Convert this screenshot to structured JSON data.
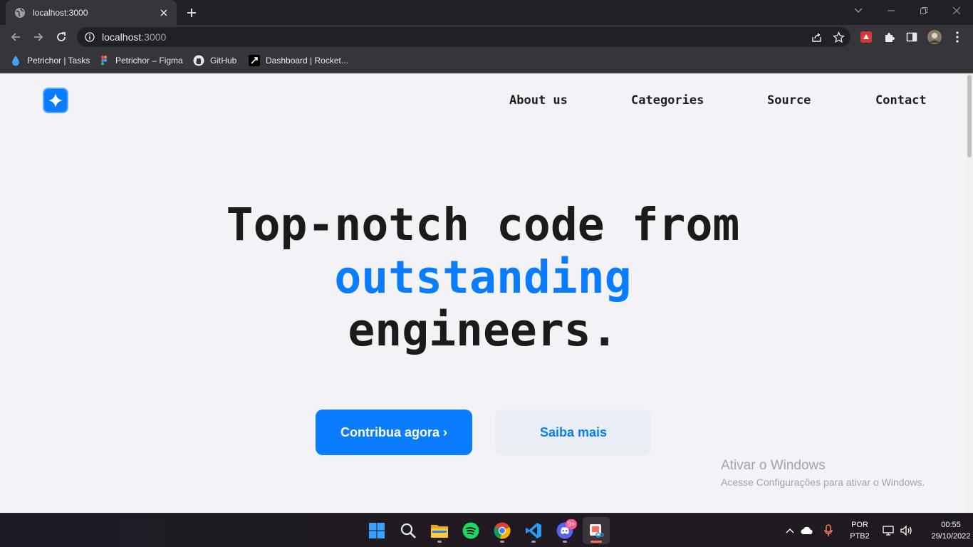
{
  "browser": {
    "tab": {
      "title": "localhost:3000"
    },
    "url": {
      "host": "localhost",
      "port": ":3000"
    },
    "bookmarks": [
      {
        "label": "Petrichor | Tasks"
      },
      {
        "label": "Petrichor – Figma"
      },
      {
        "label": "GitHub"
      },
      {
        "label": "Dashboard | Rocket..."
      }
    ]
  },
  "site": {
    "nav": [
      "About us",
      "Categories",
      "Source",
      "Contact"
    ],
    "hero": {
      "line1": "Top-notch code from",
      "accent": "outstanding",
      "line3": "engineers."
    },
    "buttons": {
      "primary": "Contribua agora ›",
      "secondary": "Saiba mais"
    },
    "colors": {
      "accent": "#0a7cff",
      "background": "#f3f2f7",
      "text": "#1b1b1b"
    }
  },
  "watermark": {
    "title": "Ativar o Windows",
    "subtitle": "Acesse Configurações para ativar o Windows."
  },
  "taskbar": {
    "apps": [
      "start-icon",
      "search-icon",
      "file-explorer-icon",
      "spotify-icon",
      "chrome-icon",
      "vscode-icon",
      "discord-icon",
      "snipping-tool-icon"
    ],
    "discord_badge": "9+",
    "language": {
      "line1": "POR",
      "line2": "PTB2"
    },
    "clock": {
      "time": "00:55",
      "date": "29/10/2022"
    }
  }
}
